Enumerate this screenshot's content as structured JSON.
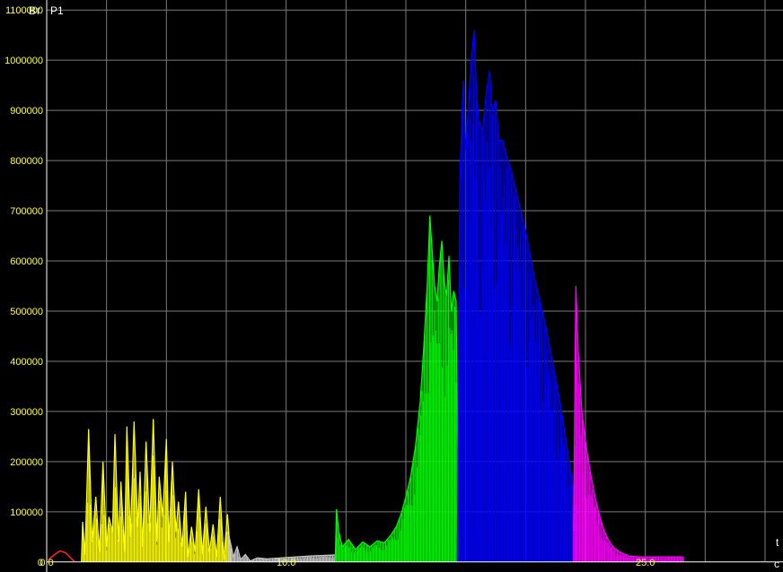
{
  "chart_data": {
    "type": "line",
    "title": "",
    "y_unit": "Вт",
    "y_name": "P1",
    "x_name": "t",
    "x_unit": "с",
    "xlim": [
      0,
      30.6
    ],
    "ylim": [
      -20000,
      1120000
    ],
    "y_ticks": [
      {
        "value": 0,
        "label": "0"
      },
      {
        "value": 100000,
        "label": "100000"
      },
      {
        "value": 200000,
        "label": "200000"
      },
      {
        "value": 300000,
        "label": "300000"
      },
      {
        "value": 400000,
        "label": "400000"
      },
      {
        "value": 500000,
        "label": "500000"
      },
      {
        "value": 600000,
        "label": "600000"
      },
      {
        "value": 700000,
        "label": "700000"
      },
      {
        "value": 800000,
        "label": "800000"
      },
      {
        "value": 900000,
        "label": "900000"
      },
      {
        "value": 1000000,
        "label": "1000000"
      },
      {
        "value": 1100000,
        "label": "1100000"
      }
    ],
    "x_grid": [
      0,
      2.5,
      5,
      7.5,
      10,
      12.5,
      15,
      17.5,
      20,
      22.5,
      25,
      27.5,
      30
    ],
    "x_tick_labels": [
      {
        "value": 0,
        "label": "0.0"
      },
      {
        "value": 10,
        "label": "10.0"
      },
      {
        "value": 25,
        "label": "25.0"
      }
    ],
    "grid": true,
    "colors": {
      "background": "#000000",
      "grid": "#7a7a7a",
      "axis": "#ffffff",
      "tick_text": "#ffff3c",
      "unit_text": "#ffffff"
    },
    "series": [
      {
        "color": "#ff2020",
        "style": "smooth",
        "points": [
          [
            0.05,
            3000
          ],
          [
            0.3,
            14000
          ],
          [
            0.55,
            22000
          ],
          [
            0.8,
            18000
          ],
          [
            1.0,
            8000
          ],
          [
            1.15,
            1000
          ]
        ]
      },
      {
        "color": "#ffff00",
        "style": "oscillation",
        "points": [
          [
            1.45,
            0
          ],
          [
            1.5,
            80000
          ],
          [
            1.6,
            15000
          ],
          [
            1.75,
            265000
          ],
          [
            1.9,
            40000
          ],
          [
            2.05,
            130000
          ],
          [
            2.2,
            20000
          ],
          [
            2.35,
            200000
          ],
          [
            2.5,
            30000
          ],
          [
            2.6,
            90000
          ],
          [
            2.75,
            60000
          ],
          [
            2.85,
            255000
          ],
          [
            3.0,
            40000
          ],
          [
            3.1,
            160000
          ],
          [
            3.25,
            20000
          ],
          [
            3.35,
            270000
          ],
          [
            3.5,
            50000
          ],
          [
            3.65,
            280000
          ],
          [
            3.8,
            70000
          ],
          [
            3.9,
            180000
          ],
          [
            4.0,
            30000
          ],
          [
            4.15,
            240000
          ],
          [
            4.3,
            60000
          ],
          [
            4.45,
            285000
          ],
          [
            4.6,
            40000
          ],
          [
            4.7,
            170000
          ],
          [
            4.85,
            90000
          ],
          [
            5.0,
            245000
          ],
          [
            5.1,
            40000
          ],
          [
            5.25,
            200000
          ],
          [
            5.4,
            60000
          ],
          [
            5.5,
            120000
          ],
          [
            5.65,
            30000
          ],
          [
            5.8,
            140000
          ],
          [
            5.9,
            10000
          ],
          [
            6.05,
            70000
          ],
          [
            6.2,
            20000
          ],
          [
            6.35,
            145000
          ],
          [
            6.5,
            15000
          ],
          [
            6.65,
            110000
          ],
          [
            6.8,
            20000
          ],
          [
            6.95,
            75000
          ],
          [
            7.1,
            10000
          ],
          [
            7.25,
            130000
          ],
          [
            7.4,
            5000
          ],
          [
            7.55,
            95000
          ],
          [
            7.7,
            0
          ]
        ]
      },
      {
        "color": "#c8c8c8",
        "style": "oscillation",
        "points": [
          [
            7.6,
            55000
          ],
          [
            7.8,
            10000
          ],
          [
            7.95,
            30000
          ],
          [
            8.1,
            5000
          ],
          [
            8.3,
            15000
          ],
          [
            8.5,
            2000
          ],
          [
            8.8,
            8000
          ],
          [
            9.2,
            6000
          ],
          [
            10.0,
            9000
          ],
          [
            11.0,
            12000
          ],
          [
            12.0,
            14000
          ],
          [
            12.1,
            14000
          ]
        ]
      },
      {
        "color": "#00ff00",
        "style": "oscillation",
        "points": [
          [
            12.05,
            0
          ],
          [
            12.1,
            105000
          ],
          [
            12.2,
            60000
          ],
          [
            12.35,
            30000
          ],
          [
            12.6,
            45000
          ],
          [
            12.9,
            25000
          ],
          [
            13.2,
            40000
          ],
          [
            13.5,
            30000
          ],
          [
            13.8,
            42000
          ],
          [
            14.1,
            38000
          ],
          [
            14.4,
            55000
          ],
          [
            14.6,
            70000
          ],
          [
            14.8,
            95000
          ],
          [
            15.0,
            130000
          ],
          [
            15.2,
            170000
          ],
          [
            15.4,
            230000
          ],
          [
            15.6,
            320000
          ],
          [
            15.75,
            430000
          ],
          [
            15.9,
            560000
          ],
          [
            16.0,
            690000
          ],
          [
            16.1,
            620000
          ],
          [
            16.2,
            550000
          ],
          [
            16.3,
            520000
          ],
          [
            16.4,
            590000
          ],
          [
            16.5,
            640000
          ],
          [
            16.6,
            560000
          ],
          [
            16.7,
            530000
          ],
          [
            16.8,
            610000
          ],
          [
            16.9,
            500000
          ],
          [
            17.0,
            540000
          ],
          [
            17.1,
            520000
          ],
          [
            17.2,
            10000
          ]
        ]
      },
      {
        "color": "#0000ff",
        "style": "oscillation",
        "points": [
          [
            17.15,
            0
          ],
          [
            17.25,
            760000
          ],
          [
            17.4,
            960000
          ],
          [
            17.5,
            820000
          ],
          [
            17.6,
            900000
          ],
          [
            17.75,
            1010000
          ],
          [
            17.85,
            1060000
          ],
          [
            17.95,
            930000
          ],
          [
            18.05,
            880000
          ],
          [
            18.2,
            860000
          ],
          [
            18.35,
            930000
          ],
          [
            18.5,
            980000
          ],
          [
            18.6,
            900000
          ],
          [
            18.75,
            920000
          ],
          [
            18.9,
            840000
          ],
          [
            19.05,
            840000
          ],
          [
            19.2,
            810000
          ],
          [
            19.4,
            780000
          ],
          [
            19.6,
            740000
          ],
          [
            19.8,
            700000
          ],
          [
            20.0,
            660000
          ],
          [
            20.2,
            610000
          ],
          [
            20.4,
            560000
          ],
          [
            20.6,
            520000
          ],
          [
            20.8,
            480000
          ],
          [
            21.0,
            430000
          ],
          [
            21.2,
            380000
          ],
          [
            21.4,
            330000
          ],
          [
            21.6,
            270000
          ],
          [
            21.8,
            210000
          ],
          [
            22.0,
            140000
          ],
          [
            22.15,
            60000
          ]
        ]
      },
      {
        "color": "#ff00ff",
        "style": "oscillation",
        "points": [
          [
            22.0,
            60000
          ],
          [
            22.1,
            550000
          ],
          [
            22.2,
            420000
          ],
          [
            22.35,
            300000
          ],
          [
            22.5,
            240000
          ],
          [
            22.7,
            180000
          ],
          [
            22.9,
            130000
          ],
          [
            23.1,
            90000
          ],
          [
            23.3,
            60000
          ],
          [
            23.5,
            40000
          ],
          [
            23.7,
            28000
          ],
          [
            24.0,
            18000
          ],
          [
            24.3,
            12000
          ],
          [
            24.8,
            10000
          ],
          [
            25.4,
            10000
          ],
          [
            26.0,
            10000
          ],
          [
            26.6,
            10000
          ]
        ]
      }
    ]
  }
}
